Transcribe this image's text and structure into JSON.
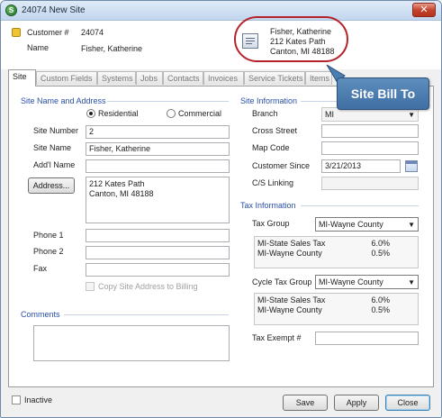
{
  "window": {
    "title": "24074 New Site",
    "close_glyph": "✕"
  },
  "header": {
    "customer_label": "Customer #",
    "customer_number": "24074",
    "name_label": "Name",
    "name_value": "Fisher, Katherine",
    "bill_to": {
      "line1": "Fisher, Katherine",
      "line2": "212  Kates Path",
      "line3": "Canton, MI  48188"
    }
  },
  "tabs": [
    {
      "label": "Site"
    },
    {
      "label": "Custom Fields"
    },
    {
      "label": "Systems"
    },
    {
      "label": "Jobs"
    },
    {
      "label": "Contacts"
    },
    {
      "label": "Invoices"
    },
    {
      "label": "Service Tickets"
    },
    {
      "label": "Items"
    }
  ],
  "callout": {
    "label": "Site Bill To"
  },
  "site": {
    "section_title": "Site Name and Address",
    "residential_label": "Residential",
    "commercial_label": "Commercial",
    "site_number_label": "Site Number",
    "site_number_value": "2",
    "site_name_label": "Site Name",
    "site_name_value": "Fisher, Katherine",
    "addl_name_label": "Add'l Name",
    "addl_name_value": "",
    "address_button": "Address...",
    "address_line1": "212  Kates Path",
    "address_line2": "Canton, MI  48188",
    "phone1_label": "Phone 1",
    "phone2_label": "Phone 2",
    "fax_label": "Fax",
    "copy_label": "Copy Site Address to Billing"
  },
  "comments": {
    "label": "Comments",
    "value": ""
  },
  "site_info": {
    "section_title": "Site Information",
    "branch_label": "Branch",
    "branch_value": "MI",
    "cross_street_label": "Cross Street",
    "map_code_label": "Map Code",
    "customer_since_label": "Customer Since",
    "customer_since_value": "3/21/2013",
    "cs_linking_label": "C/S Linking"
  },
  "tax": {
    "section_title": "Tax Information",
    "tax_group_label": "Tax Group",
    "tax_group_value": "MI-Wayne County",
    "tax_group_items": [
      {
        "name": "MI-State Sales Tax",
        "rate": "6.0%"
      },
      {
        "name": "MI-Wayne County",
        "rate": "0.5%"
      }
    ],
    "cycle_tax_group_label": "Cycle Tax Group",
    "cycle_tax_group_value": "MI-Wayne County",
    "cycle_tax_items": [
      {
        "name": "MI-State Sales Tax",
        "rate": "6.0%"
      },
      {
        "name": "MI-Wayne County",
        "rate": "0.5%"
      }
    ],
    "tax_exempt_label": "Tax Exempt #"
  },
  "footer": {
    "inactive_label": "Inactive",
    "save_label": "Save",
    "apply_label": "Apply",
    "close_label": "Close"
  },
  "icons": {
    "app": "app-logo-icon",
    "lock": "lock-icon",
    "bill_to": "address-card-icon",
    "calendar": "calendar-icon",
    "dropdown": "chevron-down-icon"
  },
  "colors": {
    "section_heading": "#2a4fa8",
    "callout_bg": "#4a7db2",
    "highlight_oval": "#b4232a"
  }
}
